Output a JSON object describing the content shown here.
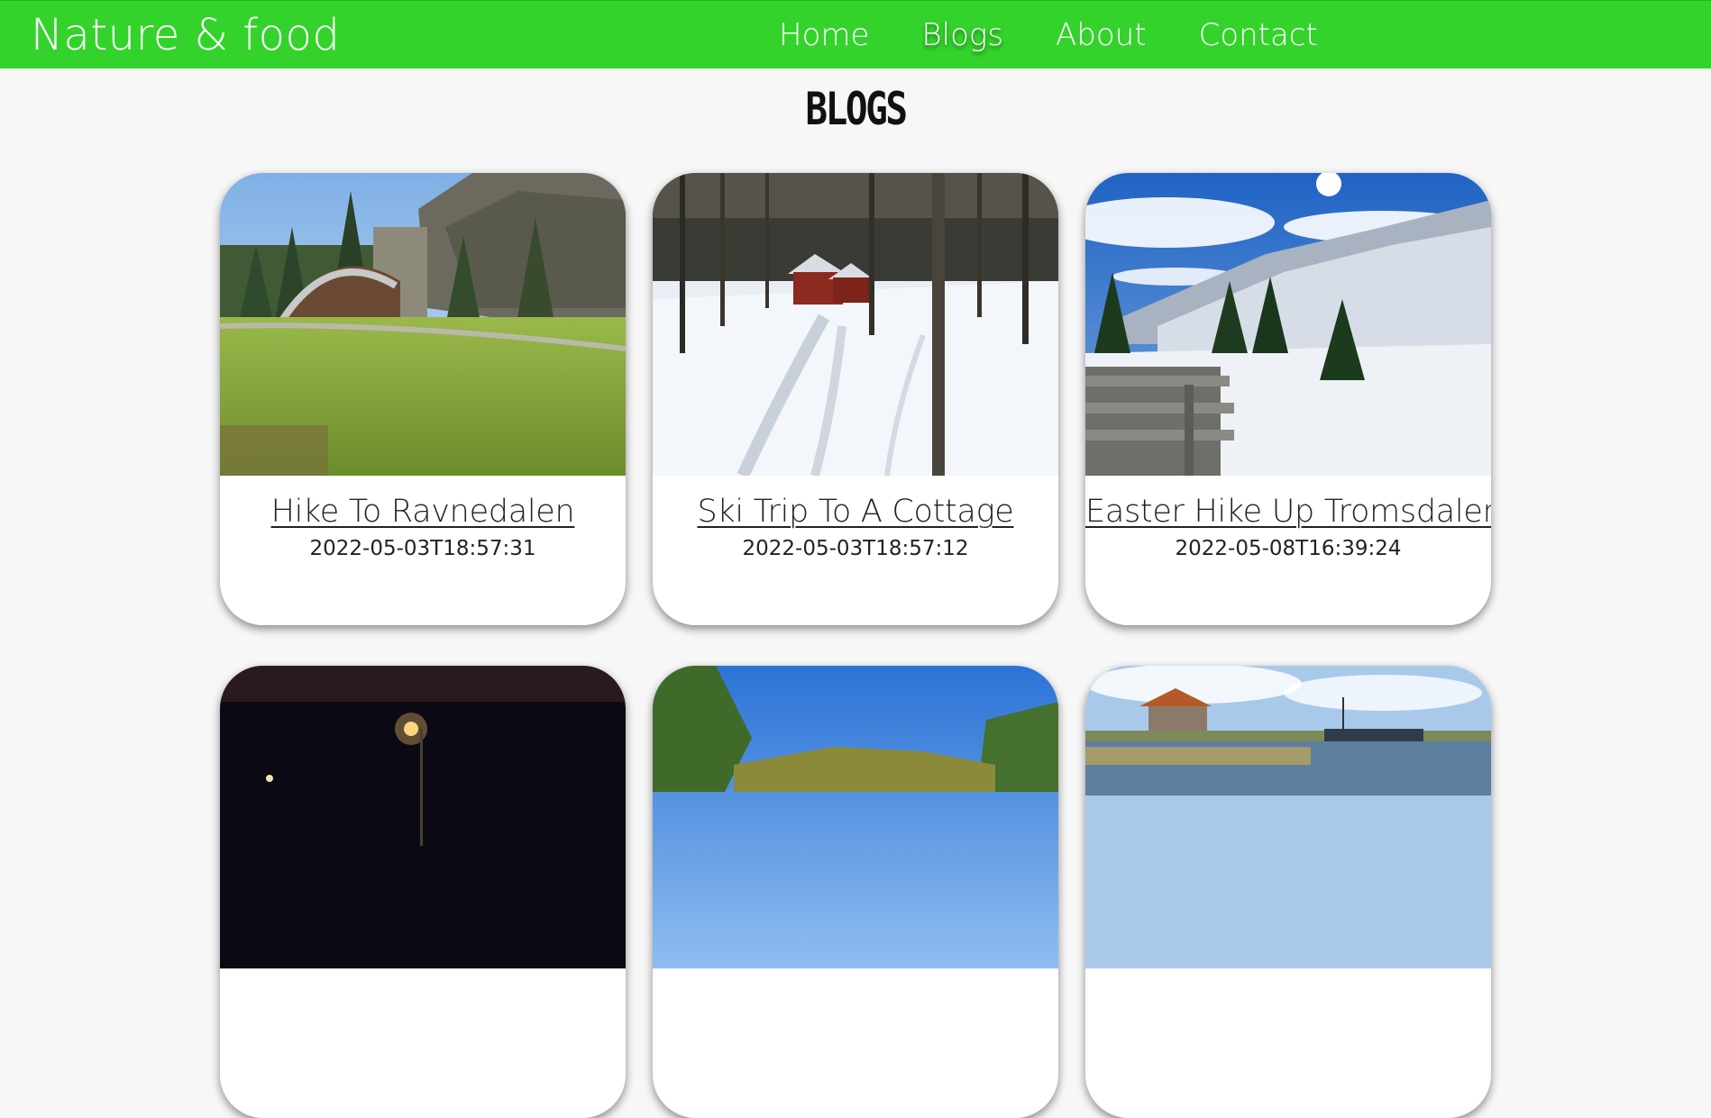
{
  "header": {
    "logo_text": "Nature & food",
    "nav": [
      {
        "label": "Home"
      },
      {
        "label": "Blogs"
      },
      {
        "label": "About"
      },
      {
        "label": "Contact"
      }
    ],
    "active_nav": "Blogs",
    "brand_color": "#34d32c"
  },
  "main": {
    "title": "BLOGS",
    "posts": [
      {
        "title": "Hike To Ravnedalen",
        "date": "2022-05-03T18:57:31",
        "image": "park-bandshell-photo"
      },
      {
        "title": "Ski Trip To A Cottage",
        "date": "2022-05-03T18:57:12",
        "image": "snowy-cottage-photo"
      },
      {
        "title": "Easter Hike Up Tromsdalen",
        "date": "2022-05-08T16:39:24",
        "image": "snowy-mountain-photo"
      },
      {
        "title": "",
        "date": "",
        "image": "night-street-photo"
      },
      {
        "title": "",
        "date": "",
        "image": "forest-lake-photo"
      },
      {
        "title": "",
        "date": "",
        "image": "harbor-photo"
      }
    ]
  }
}
